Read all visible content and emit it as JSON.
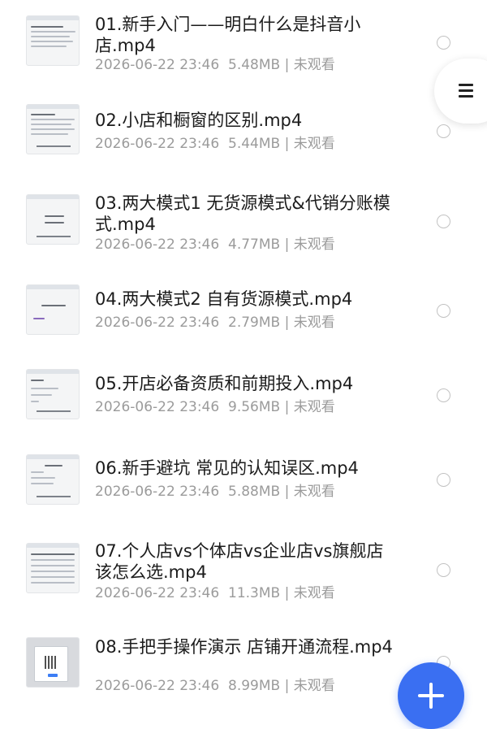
{
  "files": [
    {
      "title": "01.新手入门——明白什么是抖音小店.mp4",
      "date": "2026-06-22 23:46",
      "size": "5.48MB",
      "status": "未观看"
    },
    {
      "title": "02.小店和橱窗的区别.mp4",
      "date": "2026-06-22 23:46",
      "size": "5.44MB",
      "status": "未观看"
    },
    {
      "title": "03.两大模式1 无货源模式&代销分账模式.mp4",
      "date": "2026-06-22 23:46",
      "size": "4.77MB",
      "status": "未观看"
    },
    {
      "title": "04.两大模式2 自有货源模式.mp4",
      "date": "2026-06-22 23:46",
      "size": "2.79MB",
      "status": "未观看"
    },
    {
      "title": "05.开店必备资质和前期投入.mp4",
      "date": "2026-06-22 23:46",
      "size": "9.56MB",
      "status": "未观看"
    },
    {
      "title": "06.新手避坑 常见的认知误区.mp4",
      "date": "2026-06-22 23:46",
      "size": "5.88MB",
      "status": "未观看"
    },
    {
      "title": "07.个人店vs个体店vs企业店vs旗舰店该怎么选.mp4",
      "date": "2026-06-22 23:46",
      "size": "11.3MB",
      "status": "未观看"
    },
    {
      "title": "08.手把手操作演示 店铺开通流程.mp4",
      "date": "2026-06-22 23:46",
      "size": "8.99MB",
      "status": "未观看"
    }
  ],
  "meta_separator": "|",
  "icons": {
    "menu": "hamburger-menu-icon",
    "add": "plus-icon",
    "select": "radio-circle-icon"
  },
  "colors": {
    "accent": "#3a6ff2",
    "title": "#1b1b1b",
    "meta": "#9b9b9b"
  }
}
